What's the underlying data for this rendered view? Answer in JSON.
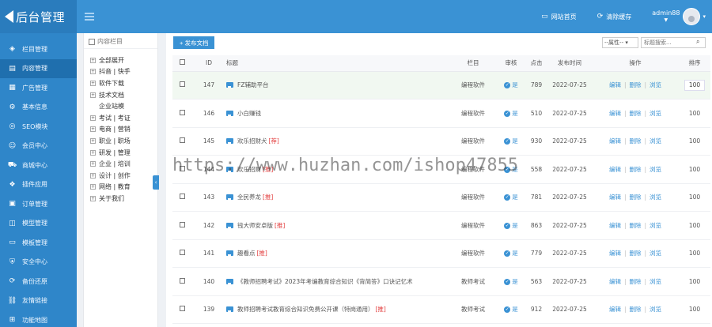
{
  "app": {
    "logo_text": "后台管理"
  },
  "topbar": {
    "site_home_label": "网站首页",
    "clear_cache_label": "清除缓存",
    "username": "admin88",
    "caret": "▼",
    "dropdown_caret": "▾"
  },
  "sidebar": {
    "items": [
      {
        "label": "栏目管理",
        "icon": "layers-icon",
        "glyph": "◈"
      },
      {
        "label": "内容管理",
        "icon": "document-icon",
        "glyph": "▤"
      },
      {
        "label": "广告管理",
        "icon": "ad-icon",
        "glyph": "▦"
      },
      {
        "label": "基本信息",
        "icon": "gear-icon",
        "glyph": "⚙"
      },
      {
        "label": "SEO模块",
        "icon": "seo-icon",
        "glyph": "◎"
      },
      {
        "label": "会员中心",
        "icon": "user-icon",
        "glyph": "☺"
      },
      {
        "label": "商城中心",
        "icon": "cart-icon",
        "glyph": "⛟"
      },
      {
        "label": "插件应用",
        "icon": "plugin-icon",
        "glyph": "❖"
      },
      {
        "label": "订单管理",
        "icon": "order-icon",
        "glyph": "▣"
      },
      {
        "label": "模型管理",
        "icon": "model-icon",
        "glyph": "◫"
      },
      {
        "label": "模板管理",
        "icon": "template-icon",
        "glyph": "▭"
      },
      {
        "label": "安全中心",
        "icon": "shield-icon",
        "glyph": "⛨"
      },
      {
        "label": "备份还原",
        "icon": "backup-icon",
        "glyph": "⟳"
      },
      {
        "label": "友情链接",
        "icon": "link-icon",
        "glyph": "⛓"
      },
      {
        "label": "功能地图",
        "icon": "map-icon",
        "glyph": "⊞"
      }
    ],
    "active_index": 1
  },
  "column_panel": {
    "title": "内容栏目",
    "collapse_glyph": "‹",
    "tree": [
      {
        "label": "全部展开",
        "expandable": true
      },
      {
        "label": "抖音 | 快手",
        "expandable": true
      },
      {
        "label": "软件下载",
        "expandable": true
      },
      {
        "label": "技术文档",
        "expandable": true
      },
      {
        "label": "企业站模",
        "expandable": false
      },
      {
        "label": "考试 | 考证",
        "expandable": true
      },
      {
        "label": "电商 | 营销",
        "expandable": true
      },
      {
        "label": "职业 | 职场",
        "expandable": true
      },
      {
        "label": "研发 | 管理",
        "expandable": true
      },
      {
        "label": "企业 | 培训",
        "expandable": true
      },
      {
        "label": "设计 | 创作",
        "expandable": true
      },
      {
        "label": "网络 | 教育",
        "expandable": true
      },
      {
        "label": "关于我们",
        "expandable": true
      }
    ]
  },
  "toolbar": {
    "add_label": "+ 发布文档",
    "filter_label": "--属性-- ▾",
    "search_placeholder": "标题搜索...",
    "search_glyph": "⌕"
  },
  "table": {
    "headers": {
      "id": "ID",
      "title": "标题",
      "column": "栏目",
      "audit": "审核",
      "hits": "点击",
      "time": "发布时间",
      "ops": "操作",
      "sort": "排序"
    },
    "ops": {
      "edit": "编辑",
      "delete": "删除",
      "view": "浏览",
      "sep": "|"
    },
    "audit_glyph": "✓",
    "rows": [
      {
        "id": "147",
        "title": "FZ辅助平台",
        "tag": "",
        "column": "编程软件",
        "audit": "是",
        "hits": "789",
        "time": "2022-07-25",
        "sort": "100"
      },
      {
        "id": "146",
        "title": "小白赚钱",
        "tag": "",
        "column": "编程软件",
        "audit": "是",
        "hits": "510",
        "time": "2022-07-25",
        "sort": "100"
      },
      {
        "id": "145",
        "title": "欢乐招财犬",
        "tag": "[荐]",
        "column": "编程软件",
        "audit": "是",
        "hits": "930",
        "time": "2022-07-25",
        "sort": "100"
      },
      {
        "id": "144",
        "title": "欢乐招财",
        "tag": "[推]",
        "column": "编程软件",
        "audit": "是",
        "hits": "558",
        "time": "2022-07-25",
        "sort": "100"
      },
      {
        "id": "143",
        "title": "全民养龙",
        "tag": "[推]",
        "column": "编程软件",
        "audit": "是",
        "hits": "781",
        "time": "2022-07-25",
        "sort": "100"
      },
      {
        "id": "142",
        "title": "钱大师安卓版",
        "tag": "[推]",
        "column": "编程软件",
        "audit": "是",
        "hits": "863",
        "time": "2022-07-25",
        "sort": "100"
      },
      {
        "id": "141",
        "title": "趣看点",
        "tag": "[推]",
        "column": "编程软件",
        "audit": "是",
        "hits": "779",
        "time": "2022-07-25",
        "sort": "100"
      },
      {
        "id": "140",
        "title": "《教师招聘考试》2023年考编教育综合知识《背简答》口诀记忆术",
        "tag": "",
        "column": "教师考试",
        "audit": "是",
        "hits": "563",
        "time": "2022-07-25",
        "sort": "100"
      },
      {
        "id": "139",
        "title": "教师招聘考试教育综合知识免费公开课（特岗通用）",
        "tag": "[推]",
        "column": "教师考试",
        "audit": "是",
        "hits": "912",
        "time": "2022-07-25",
        "sort": "100"
      }
    ]
  },
  "watermark": "https://www.huzhan.com/ishop47855"
}
